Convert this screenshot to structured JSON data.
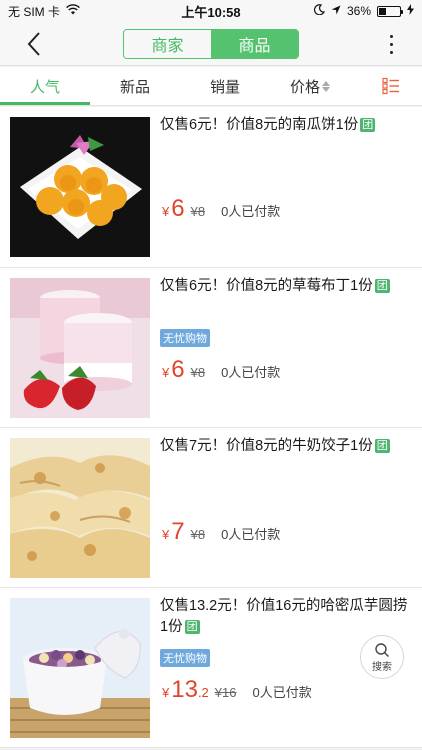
{
  "status_bar": {
    "carrier": "无 SIM 卡",
    "time": "上午10:58",
    "battery_percent": "36%",
    "battery_level": 0.36
  },
  "navbar": {
    "segments": [
      "商家",
      "商品"
    ],
    "active_segment": "商品"
  },
  "tabs": [
    "人气",
    "新品",
    "销量",
    "价格"
  ],
  "active_tab": "人气",
  "items": [
    {
      "title": "仅售6元！价值8元的南瓜饼1份",
      "badge": "团",
      "tag": "",
      "currency": "¥",
      "price": "6",
      "price_decimal": "",
      "original_price": "¥8",
      "sold": "0人已付款",
      "image": "pumpkin-cakes-photo"
    },
    {
      "title": "仅售6元！价值8元的草莓布丁1份",
      "badge": "团",
      "tag": "无忧购物",
      "currency": "¥",
      "price": "6",
      "price_decimal": "",
      "original_price": "¥8",
      "sold": "0人已付款",
      "image": "strawberry-pudding-photo"
    },
    {
      "title": "仅售7元！价值8元的牛奶饺子1份",
      "badge": "团",
      "tag": "",
      "currency": "¥",
      "price": "7",
      "price_decimal": "",
      "original_price": "¥8",
      "sold": "0人已付款",
      "image": "milk-dumplings-photo"
    },
    {
      "title": "仅售13.2元！价值16元的哈密瓜芋圆捞1份",
      "badge": "团",
      "tag": "无忧购物",
      "currency": "¥",
      "price": "13",
      "price_decimal": ".2",
      "original_price": "¥16",
      "sold": "0人已付款",
      "image": "taro-ball-dessert-photo"
    }
  ],
  "fab": {
    "label": "搜索"
  },
  "colors": {
    "accent": "#55c26f",
    "price": "#e0452a",
    "tag": "#6fa8dc"
  }
}
